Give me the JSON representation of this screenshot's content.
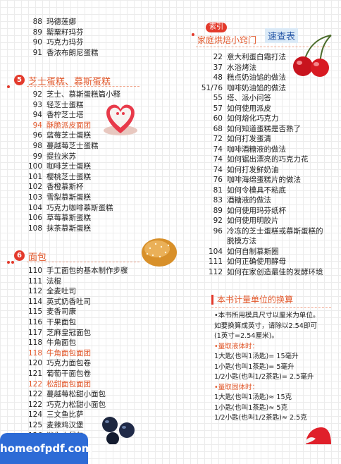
{
  "col1_top": [
    {
      "p": "88",
      "t": "玛德莲娜"
    },
    {
      "p": "89",
      "t": "罂粟籽玛芬"
    },
    {
      "p": "90",
      "t": "巧克力玛芬"
    },
    {
      "p": "91",
      "t": "香浓布朗尼蛋糕"
    }
  ],
  "section5": {
    "num": "5",
    "title": "芝士蛋糕、慕斯蛋糕"
  },
  "col1_s5": [
    {
      "p": "92",
      "t": "芝士、慕斯蛋糕篇小释",
      "hl": false
    },
    {
      "p": "93",
      "t": "轻芝士蛋糕",
      "hl": false
    },
    {
      "p": "94",
      "t": "香柠芝士塔",
      "hl": false
    },
    {
      "p": "94",
      "t": "酥脆派皮面团",
      "hl": true
    },
    {
      "p": "96",
      "t": "蓝莓芝士蛋糕",
      "hl": false
    },
    {
      "p": "98",
      "t": "蔓越莓芝士蛋糕",
      "hl": false
    },
    {
      "p": "99",
      "t": "提拉米苏",
      "hl": false
    },
    {
      "p": "100",
      "t": "咖啡芝士蛋糕",
      "hl": false
    },
    {
      "p": "101",
      "t": "樱桃芝士蛋糕",
      "hl": false
    },
    {
      "p": "102",
      "t": "香橙慕斯杯",
      "hl": false
    },
    {
      "p": "103",
      "t": "雪梨慕斯蛋糕",
      "hl": false
    },
    {
      "p": "104",
      "t": "巧克力咖啡慕斯蛋糕",
      "hl": false
    },
    {
      "p": "106",
      "t": "草莓慕斯蛋糕",
      "hl": false
    },
    {
      "p": "108",
      "t": "抹茶慕斯蛋糕",
      "hl": false
    }
  ],
  "section6": {
    "num": "6",
    "title": "面包"
  },
  "col1_s6": [
    {
      "p": "110",
      "t": "手工面包的基本制作步骤",
      "hl": false
    },
    {
      "p": "111",
      "t": "法棍",
      "hl": false
    },
    {
      "p": "112",
      "t": "全麦吐司",
      "hl": false
    },
    {
      "p": "114",
      "t": "英式奶香吐司",
      "hl": false
    },
    {
      "p": "115",
      "t": "麦香司康",
      "hl": false
    },
    {
      "p": "116",
      "t": "干果面包",
      "hl": false
    },
    {
      "p": "117",
      "t": "芝麻皇冠面包",
      "hl": false
    },
    {
      "p": "118",
      "t": "牛角面包",
      "hl": false
    },
    {
      "p": "118",
      "t": "牛角面包面团",
      "hl": true
    },
    {
      "p": "120",
      "t": "巧克力面包卷",
      "hl": false
    },
    {
      "p": "121",
      "t": "葡萄干面包卷",
      "hl": false
    },
    {
      "p": "122",
      "t": "松甜面包面团",
      "hl": true
    },
    {
      "p": "122",
      "t": "蔓越莓松甜小面包",
      "hl": false
    },
    {
      "p": "122",
      "t": "巧克力松甜小面包",
      "hl": false
    },
    {
      "p": "124",
      "t": "三文鱼比萨",
      "hl": false
    },
    {
      "p": "125",
      "t": "麦辣鸡汉堡",
      "hl": false
    },
    {
      "p": "126",
      "t": "迷你小餐包",
      "hl": false
    }
  ],
  "index_header": {
    "badge": "索引",
    "title": "家庭烘焙小窍门",
    "quick": "速查表"
  },
  "col2_index": [
    {
      "p": "22",
      "t": "意大利蛋白霜打法"
    },
    {
      "p": "37",
      "t": "水浴烤法"
    },
    {
      "p": "48",
      "t": "糕点奶油馅的做法"
    },
    {
      "p": "51/76",
      "t": "咖啡奶油馅的做法"
    },
    {
      "p": "55",
      "t": "塔、派小问答"
    },
    {
      "p": "57",
      "t": "如何使用派皮"
    },
    {
      "p": "60",
      "t": "如何熔化巧克力"
    },
    {
      "p": "68",
      "t": "如何知道蛋糕是否熟了"
    },
    {
      "p": "72",
      "t": "如何打发蛋清"
    },
    {
      "p": "74",
      "t": "咖啡酒糖液的做法"
    },
    {
      "p": "74",
      "t": "如何锯出漂亮的巧克力花"
    },
    {
      "p": "74",
      "t": "如何打发鲜奶油"
    },
    {
      "p": "76",
      "t": "咖啡海绵蛋糕片的做法"
    },
    {
      "p": "81",
      "t": "如何令模具不粘底"
    },
    {
      "p": "83",
      "t": "酒糖液的做法"
    },
    {
      "p": "89",
      "t": "如何使用玛芬纸杯"
    },
    {
      "p": "92",
      "t": "如何使用明胶片"
    },
    {
      "p": "96",
      "t": "冷冻的芝士蛋糕或慕斯蛋糕的"
    },
    {
      "p": "",
      "t": "脱模方法"
    },
    {
      "p": "104",
      "t": "如何自制慕斯圈"
    },
    {
      "p": "111",
      "t": "如何正确使用酵母"
    },
    {
      "p": "112",
      "t": "如何在家创造最佳的发酵环境"
    }
  ],
  "units": {
    "title": "本书计量单位的换算",
    "lines": [
      {
        "t": "•本书所用模具尺寸以厘米为单位。",
        "sub": false
      },
      {
        "t": "如要换算成英寸，请除以2.54即可",
        "sub": false
      },
      {
        "t": "(1英寸=2.54厘米)。",
        "sub": false
      },
      {
        "t": "•量取液体时：",
        "sub": true
      },
      {
        "t": "1大匙(也叫1汤匙)= 15毫升",
        "sub": false
      },
      {
        "t": "1小匙(也叫1茶匙)= 5毫升",
        "sub": false
      },
      {
        "t": "1/2小匙(也叫1/2茶匙)= 2.5毫升",
        "sub": false
      },
      {
        "t": "•量取固体时：",
        "sub": true
      },
      {
        "t": "1大匙(也叫1汤匙)≈ 15克",
        "sub": false
      },
      {
        "t": "1小匙(也叫1茶匙)≈ 5克",
        "sub": false
      },
      {
        "t": "1/2小匙(也叫1/2茶匙)≈ 2.5克",
        "sub": false
      }
    ]
  },
  "watermark": "homeofpdf.com"
}
